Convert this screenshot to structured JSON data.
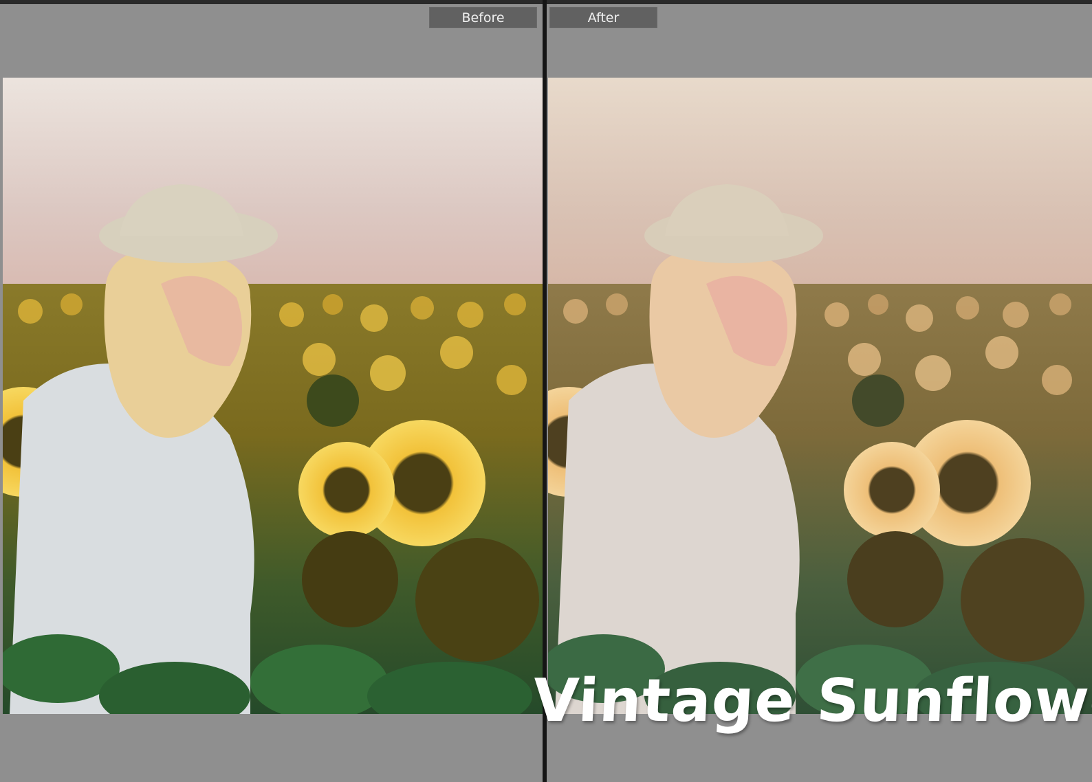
{
  "comparison": {
    "before_label": "Before",
    "after_label": "After"
  },
  "watermark": {
    "text": "Vintage Sunflower"
  },
  "colors": {
    "pane_background": "#8f8f8f",
    "label_background": "#616161",
    "divider": "#151515",
    "before_sky_top": "#e8ddd4",
    "before_sky_bottom": "#d9c3bc",
    "after_sky_top": "#e6d7c8",
    "after_sky_bottom": "#d8c0b3"
  }
}
